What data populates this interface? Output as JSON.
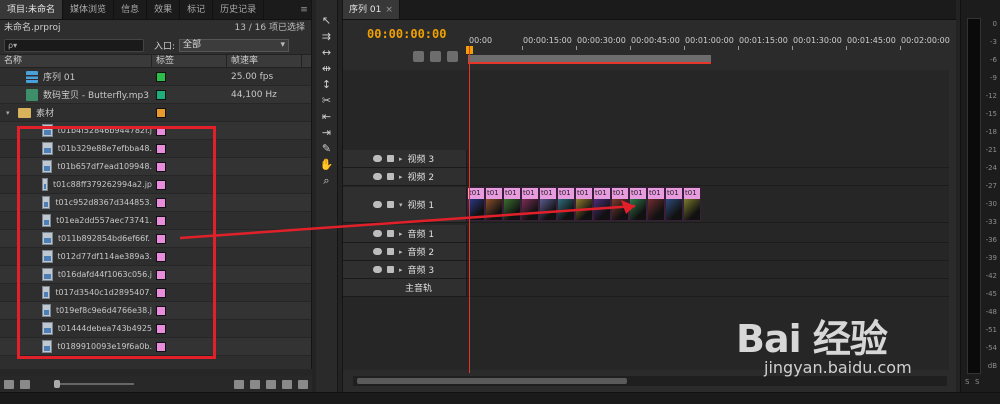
{
  "project_panel": {
    "tabs": [
      {
        "label": "项目:未命名",
        "active": true
      },
      {
        "label": "媒体浏览",
        "active": false
      },
      {
        "label": "信息",
        "active": false
      },
      {
        "label": "效果",
        "active": false
      },
      {
        "label": "标记",
        "active": false
      },
      {
        "label": "历史记录",
        "active": false
      }
    ],
    "filename": "未命名.prproj",
    "selection_count": "13 / 16 项已选择",
    "search_placeholder": "ρ▾",
    "in_label": "入口:",
    "in_value": "全部",
    "columns": {
      "name": "名称",
      "tag": "标签",
      "fps": "帧速率"
    },
    "items": [
      {
        "name": "序列 01",
        "icon": "sequence-icon",
        "tag_color": "#2ebd4a",
        "fps": "25.00 fps"
      },
      {
        "name": "数码宝贝 - Butterfly.mp3",
        "icon": "audio-file-icon",
        "tag_color": "#1fae7a",
        "fps": "44,100 Hz"
      },
      {
        "name": "素材",
        "icon": "folder-icon",
        "tag_color": "#e89a2c",
        "fps": ""
      }
    ],
    "files": [
      "t01b4f52846b944782f.j",
      "t01b329e88e7efbba48.",
      "t01b657df7ead109948.",
      "t01c88ff379262994a2.jp",
      "t01c952d8367d344853.",
      "t01ea2dd557aec73741.",
      "t011b892854bd6ef66f.",
      "t012d77df114ae389a3.",
      "t016dafd44f1063c056.j",
      "t017d3540c1d2895407.",
      "t019ef8c9e6d4766e38.j",
      "t01444debea743b4925",
      "t0189910093e19f6a0b."
    ],
    "file_tag_color": "#e88ddb"
  },
  "timeline": {
    "tab": "序列 01",
    "timecode": "00:00:00:00",
    "ruler": [
      "00:00",
      "00:00:15:00",
      "00:00:30:00",
      "00:00:45:00",
      "00:01:00:00",
      "00:01:15:00",
      "00:01:30:00",
      "00:01:45:00",
      "00:02:00:00"
    ],
    "video_tracks": [
      "视频 3",
      "视频 2",
      "视频 1"
    ],
    "audio_tracks": [
      "音频 1",
      "音频 2",
      "音频 3"
    ],
    "master": "主音轨",
    "clip_label": "t01",
    "clip_count": 13
  },
  "meter_labels": [
    "0",
    "-3",
    "-6",
    "-9",
    "-12",
    "-15",
    "-18",
    "-21",
    "-24",
    "-27",
    "-30",
    "-33",
    "-36",
    "-39",
    "-42",
    "-45",
    "-48",
    "-51",
    "-54",
    "dB"
  ],
  "meter_solo": [
    "S",
    "S"
  ],
  "watermark": {
    "main": "Bai 经验",
    "sub": "jingyan.baidu.com"
  }
}
